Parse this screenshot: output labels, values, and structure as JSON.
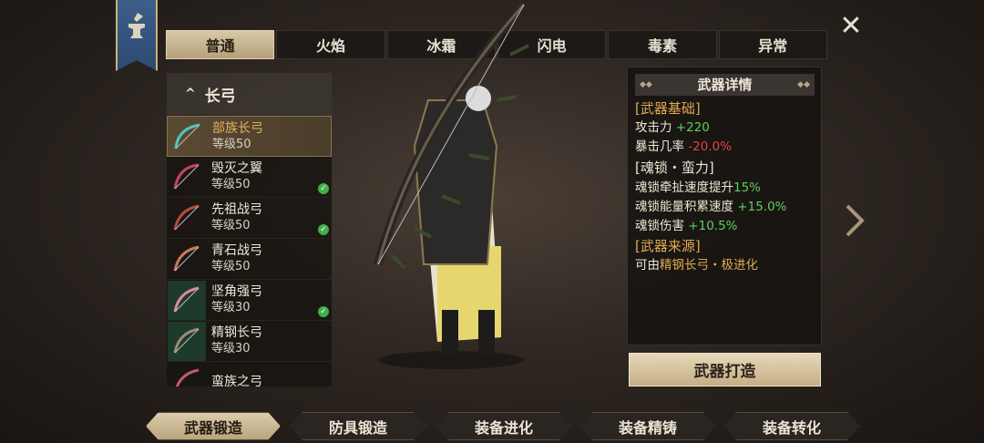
{
  "close_icon": "close-icon",
  "tabs": [
    {
      "label": "普通",
      "active": true
    },
    {
      "label": "火焰"
    },
    {
      "label": "冰霜"
    },
    {
      "label": "闪电"
    },
    {
      "label": "毒素"
    },
    {
      "label": "异常"
    }
  ],
  "category": {
    "label": "长弓",
    "icon": "chevron-up-icon"
  },
  "items": [
    {
      "name": "部族长弓",
      "level": "等级50",
      "selected": true,
      "checked": false
    },
    {
      "name": "毁灭之翼",
      "level": "等级50",
      "checked": true
    },
    {
      "name": "先祖战弓",
      "level": "等级50",
      "checked": true
    },
    {
      "name": "青石战弓",
      "level": "等级50",
      "checked": false
    },
    {
      "name": "坚角强弓",
      "level": "等级30",
      "checked": true
    },
    {
      "name": "精钢长弓",
      "level": "等级30",
      "checked": false
    },
    {
      "name": "蛮族之弓",
      "level": "",
      "checked": false
    }
  ],
  "detail": {
    "title": "武器详情",
    "base_header": "[武器基础]",
    "attack_label": "攻击力",
    "attack_value": "+220",
    "crit_label": "暴击几率",
    "crit_value": "-20.0%",
    "soul_header": "[魂锁・蛮力]",
    "soul_rows": [
      {
        "label": "魂锁牵扯速度提升",
        "value": "15%"
      },
      {
        "label": "魂锁能量积累速度",
        "value": "+15.0%"
      },
      {
        "label": "魂锁伤害",
        "value": "+10.5%"
      }
    ],
    "source_header": "[武器来源]",
    "source_prefix": "可由",
    "source_link": "精钢长弓・极进化"
  },
  "forge_button": "武器打造",
  "bottom_tabs": [
    {
      "label": "武器锻造",
      "active": true
    },
    {
      "label": "防具锻造"
    },
    {
      "label": "装备进化"
    },
    {
      "label": "装备精铸"
    },
    {
      "label": "装备转化"
    }
  ],
  "colors": {
    "accent": "#e0a950",
    "positive": "#5fd05f",
    "negative": "#e0463c"
  }
}
